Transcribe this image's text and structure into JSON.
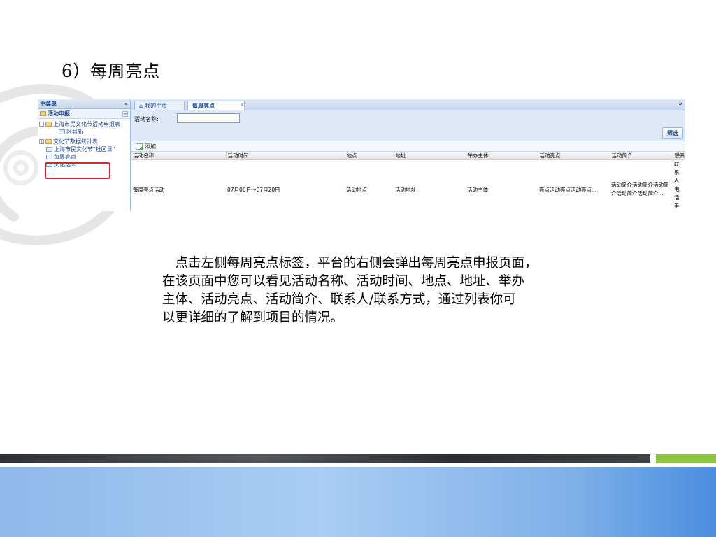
{
  "slide": {
    "title": "6）每周亮点",
    "description_lines": [
      "　点击左侧每周亮点标签，平台的右侧会弹出每周亮点申报页面，",
      "在该页面中您可以看见活动名称、活动时间、地点、地址、举办",
      "主体、活动亮点、活动简介、联系人/联系方式，通过列表你可",
      "以更详细的了解到项目的情况。"
    ]
  },
  "app": {
    "sidebar": {
      "header": "主菜单",
      "collapse_glyph": "«",
      "section": "活动申报",
      "section_toggle": "−",
      "items": [
        {
          "label": "上海市民文化节活动申报表"
        },
        {
          "label": "区县新"
        },
        {
          "label": "文化节数据统计表"
        },
        {
          "label": "上海市民文化节\"社区日\""
        },
        {
          "label": "每周亮点"
        },
        {
          "label": "文化达人"
        }
      ]
    },
    "tabs": [
      {
        "label": "我的主页",
        "icon": "home-icon"
      },
      {
        "label": "每周亮点",
        "active": true
      }
    ],
    "tab_close": "×",
    "collapse_all": "»",
    "filter": {
      "label": "活动名称:",
      "input_value": "",
      "submit_label": "筛选"
    },
    "toolbar": {
      "add_label": "添加"
    },
    "grid": {
      "columns": [
        "活动名称",
        "活动时间",
        "地点",
        "地址",
        "举办主体",
        "活动亮点",
        "活动简介",
        "联系人"
      ],
      "rows": [
        [
          "每周亮点活动",
          "07月06日～07月20日",
          "活动地点",
          "活动地址",
          "活动主体",
          "亮点活动亮点活动亮点...",
          "活动简介活动简介活动简介活动简介活动简介...",
          "联系人电话手机"
        ]
      ]
    }
  },
  "colors": {
    "highlight_border": "#d9232d",
    "accent_green": "#8cc63f",
    "footer_blue": "#8fb9ea"
  }
}
